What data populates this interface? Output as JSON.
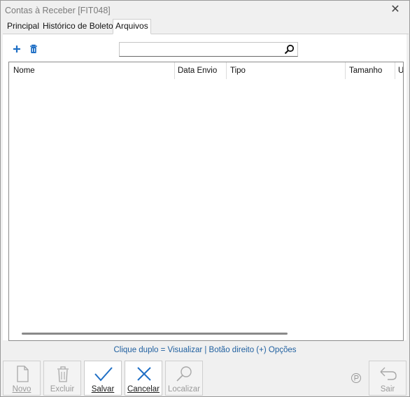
{
  "window": {
    "title": "Contas à Receber [FIT048]"
  },
  "tabs": [
    {
      "label": "Principal"
    },
    {
      "label": "Histórico de Boletos"
    },
    {
      "label": "Arquivos"
    }
  ],
  "toolbar": {
    "add_icon": "plus-icon",
    "delete_icon": "trash-icon"
  },
  "search": {
    "value": "",
    "placeholder": ""
  },
  "table": {
    "columns": [
      "Nome",
      "Data Envio",
      "Tipo",
      "Tamanho",
      "U"
    ],
    "rows": []
  },
  "hint": "Clique duplo = Visualizar | Botão direito (+) Opções",
  "buttons": {
    "novo": "Novo",
    "excluir": "Excluir",
    "salvar": "Salvar",
    "cancelar": "Cancelar",
    "localizar": "Localizar",
    "sair": "Sair"
  },
  "colors": {
    "accent": "#1f6fc5",
    "hint": "#1f5f9f"
  }
}
